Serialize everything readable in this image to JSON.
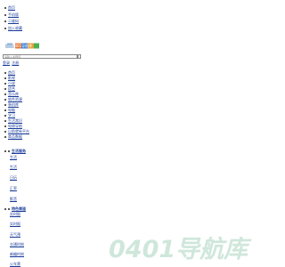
{
  "top_links": [
    "首页",
    "手机版",
    "二维码",
    "加入收藏"
  ],
  "logo": {
    "text": "0401导航库"
  },
  "search": {
    "placeholder": "请输入关键词"
  },
  "quick_links": [
    "登录",
    "注册"
  ],
  "nav_items": [
    "首页",
    "影视",
    "小说",
    "综合",
    "音乐库",
    "软件资源",
    "装机库",
    "电脑",
    "学习",
    "生活常识",
    "电商导航",
    "以前就有平台",
    "商品数据"
  ],
  "section_1": {
    "title": "生活服务",
    "title_line2": "生活",
    "items": [
      "生活",
      "日历",
      "汇率",
      "影音"
    ]
  },
  "section_2": {
    "title": "特色频道",
    "title_line2": "实时报",
    "items": [
      "实时报",
      "天气预",
      "交通时刻",
      "邮编时刻",
      "火车票"
    ]
  },
  "watermark": {
    "text": "0401导航库",
    "color": "#cfe7db"
  }
}
